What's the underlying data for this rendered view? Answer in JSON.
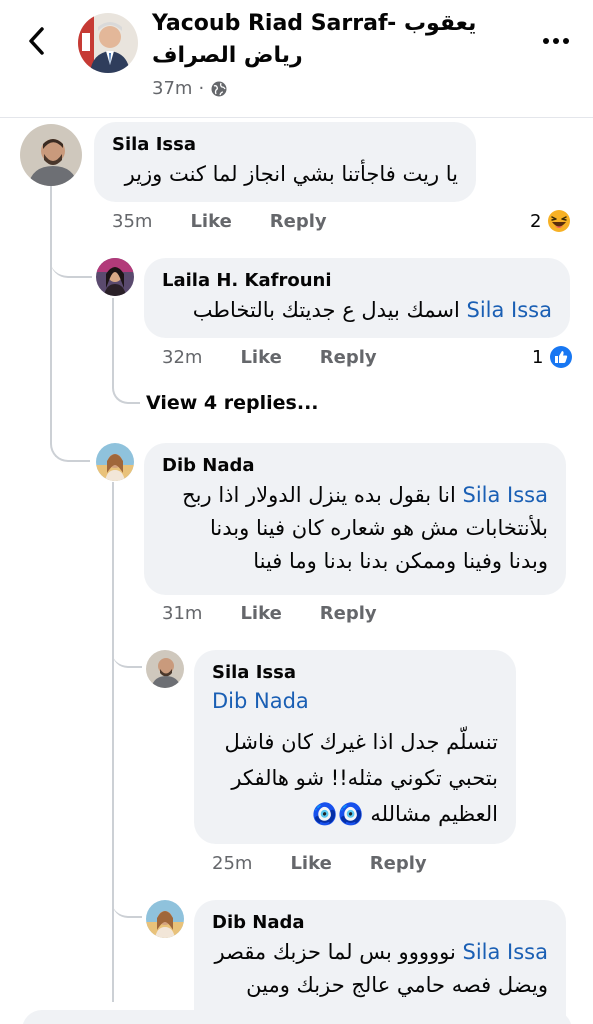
{
  "header": {
    "name": "Yacoub Riad Sarraf- يعقوب رياض الصراف",
    "time": "37m",
    "dot": "·"
  },
  "comments": [
    {
      "author": "Sila Issa",
      "text": "يا ريت فاجأتنا بشي انجاز لما كنت وزير",
      "time": "35m",
      "like": "Like",
      "reply": "Reply",
      "reaction_count": "2",
      "reaction_icon": "haha-icon",
      "reply_thread": {
        "author": "Laila H. Kafrouni",
        "mention": "Sila Issa",
        "text": "اسمك بيدل ع جديتك بالتخاطب",
        "time": "32m",
        "like": "Like",
        "reply": "Reply",
        "reaction_count": "1",
        "reaction_icon": "like-icon"
      },
      "view_replies": "View 4 replies..."
    },
    {
      "author": "Dib Nada",
      "mention": "Sila Issa",
      "text_lines": [
        "انا بقول بده ينزل الدولار اذا ربح",
        "بلأنتخابات مش هو شعاره كان فينا وبدنا",
        "وبدنا وفينا وممكن بدنا بدنا وما فينا"
      ],
      "time": "31m",
      "like": "Like",
      "reply": "Reply",
      "replies": [
        {
          "author": "Sila Issa",
          "mention": "Dib Nada",
          "text_lines": [
            "تنسلّم جدل اذا غيرك كان فاشل",
            "بتحبي تكوني مثله!! شو هالفكر",
            "العظيم مشالله"
          ],
          "emoji": "🧿🧿",
          "time": "25m",
          "like": "Like",
          "reply": "Reply"
        },
        {
          "author": "Dib Nada",
          "mention": "Sila Issa",
          "text_lines": [
            "نووووو بس لما حزبك مقصر",
            "ويضل فصه حامي عالج حزبك ومين"
          ]
        }
      ]
    }
  ],
  "colors": {
    "mention": "#1a5fb4",
    "bubble": "#f0f2f5",
    "meta": "#65676b",
    "like_blue": "#1877f2",
    "haha_yellow": "#f7b125"
  }
}
